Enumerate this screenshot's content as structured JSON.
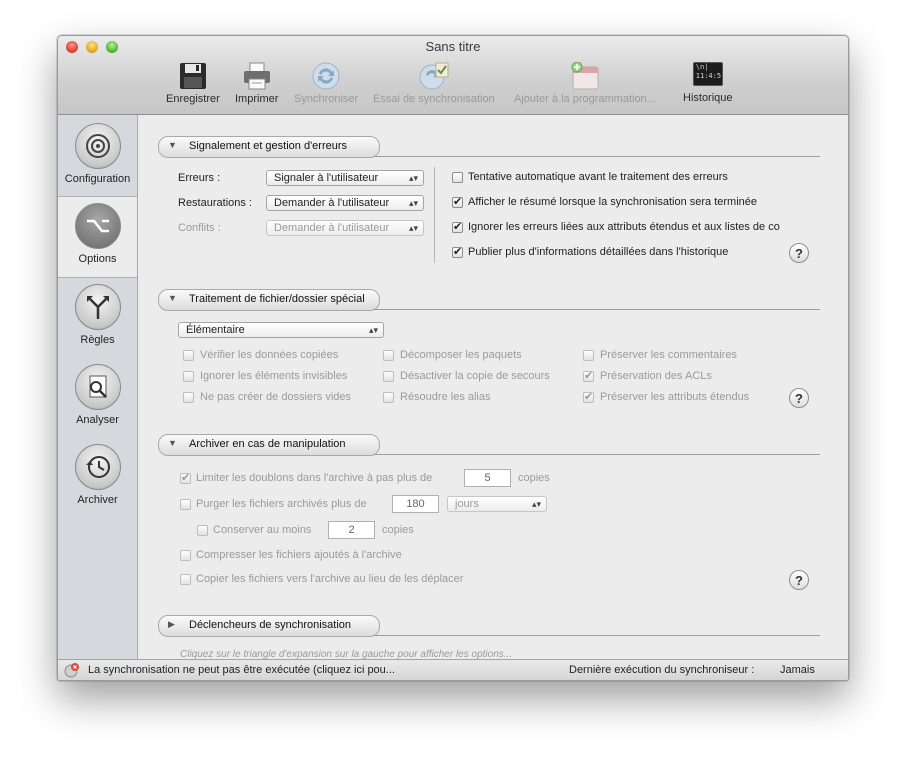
{
  "window": {
    "title": "Sans titre"
  },
  "toolbar": {
    "save": "Enregistrer",
    "print": "Imprimer",
    "sync": "Synchroniser",
    "test_sync": "Essai de synchronisation",
    "schedule": "Ajouter à la programmation...",
    "history": "Historique",
    "history_icon_text": "\\n|\n11:4:5"
  },
  "sidebar": {
    "items": [
      "Configuration",
      "Options",
      "Règles",
      "Analyser",
      "Archiver"
    ],
    "selected": "Options"
  },
  "errors": {
    "title": "Signalement et gestion d'erreurs",
    "erreurs_label": "Erreurs :",
    "erreurs_value": "Signaler à l'utilisateur",
    "restaurations_label": "Restaurations :",
    "restaurations_value": "Demander à l'utilisateur",
    "conflits_label": "Conflits :",
    "conflits_value": "Demander à l'utilisateur",
    "opt1": "Tentative automatique avant le traitement des erreurs",
    "opt2": "Afficher le résumé lorsque la synchronisation sera terminée",
    "opt3": "Ignorer les erreurs liées aux attributs étendus et aux listes de co",
    "opt4": "Publier plus d'informations détaillées dans l'historique",
    "help": "?"
  },
  "special": {
    "title": "Traitement de fichier/dossier spécial",
    "mode": "Élémentaire",
    "c1": "Vérifier les données copiées",
    "c2": "Ignorer les éléments invisibles",
    "c3": "Ne pas créer de dossiers vides",
    "c4": "Décomposer les paquets",
    "c5": "Désactiver la copie de secours",
    "c6": "Résoudre les alias",
    "c7": "Préserver les commentaires",
    "c8": "Préservation des ACLs",
    "c9": "Préserver les attributs étendus",
    "help": "?"
  },
  "archive": {
    "title": "Archiver en cas de manipulation",
    "limit_label": "Limiter les doublons dans l'archive à pas plus de",
    "limit_value": "5",
    "limit_unit": "copies",
    "purge_label": "Purger les fichiers archivés plus de",
    "purge_value": "180",
    "purge_unit": "jours",
    "keep_label": "Conserver au moins",
    "keep_value": "2",
    "keep_unit": "copies",
    "compress_label": "Compresser les fichiers ajoutés à l'archive",
    "copy_label": "Copier les fichiers vers l'archive au lieu de les déplacer",
    "help": "?"
  },
  "triggers": {
    "title": "Déclencheurs de synchronisation",
    "hint": "Cliquez sur le triangle d'expansion sur la gauche pour afficher les options..."
  },
  "status": {
    "message": "La synchronisation ne peut pas être exécutée (cliquez ici pou...",
    "last_label": "Dernière exécution du synchroniseur :",
    "last_value": "Jamais"
  }
}
